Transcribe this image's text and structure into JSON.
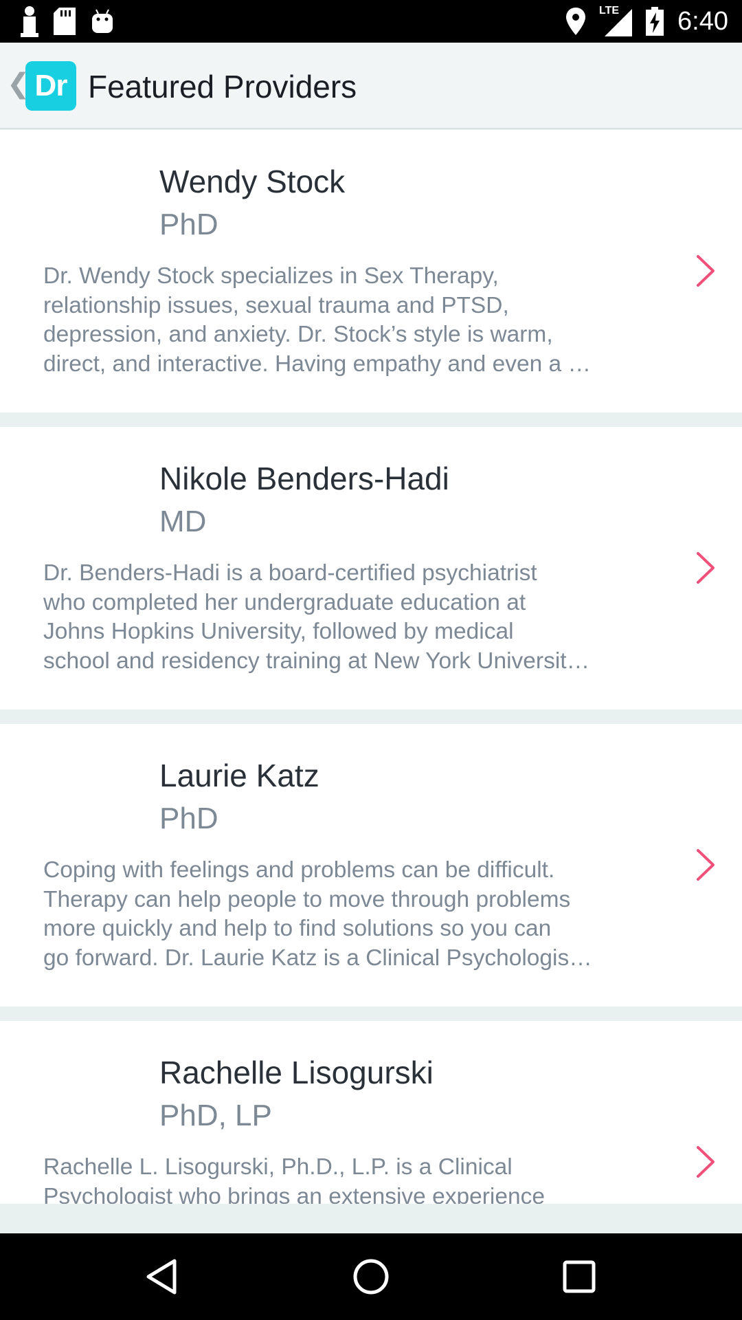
{
  "status_bar": {
    "time": "6:40",
    "network": "LTE",
    "icons_left": [
      "notification-icon",
      "sd-card-icon",
      "android-icon"
    ],
    "icons_right": [
      "location-icon",
      "signal-icon",
      "battery-charging-icon"
    ]
  },
  "app_bar": {
    "logo_text": "Dr",
    "title": "Featured Providers",
    "accent_color": "#17cfe0"
  },
  "providers": [
    {
      "name": "Wendy Stock",
      "credentials": "PhD",
      "description_lines": [
        "Dr. Wendy Stock specializes in Sex Therapy,",
        "relationship issues, sexual trauma and PTSD,",
        "depression, and anxiety. Dr. Stock’s style is warm,",
        "direct, and interactive. Having empathy and even a …"
      ]
    },
    {
      "name": "Nikole Benders-Hadi",
      "credentials": "MD",
      "description_lines": [
        "Dr. Benders-Hadi is a board-certified psychiatrist",
        "who completed her undergraduate education at",
        "Johns Hopkins University, followed by medical",
        "school and residency training at New York Universit…"
      ]
    },
    {
      "name": "Laurie Katz",
      "credentials": "PhD",
      "description_lines": [
        "Coping with feelings and problems can be difficult.",
        "Therapy can help people to move through problems",
        "more quickly and help to find solutions so you can",
        "go forward. Dr. Laurie Katz is a Clinical Psychologis…"
      ]
    },
    {
      "name": "Rachelle Lisogurski",
      "credentials": "PhD, LP",
      "description_lines": [
        "Rachelle L. Lisogurski, Ph.D., L.P. is a Clinical",
        "Psychologist who brings an extensive experience"
      ]
    }
  ],
  "colors": {
    "chevron": "#f0507a",
    "name_text": "#2a3038",
    "secondary_text": "#7d8895",
    "separator": "#e9f0f0"
  },
  "nav_bar": {
    "buttons": [
      "back-triangle-icon",
      "home-circle-icon",
      "recents-square-icon"
    ]
  }
}
